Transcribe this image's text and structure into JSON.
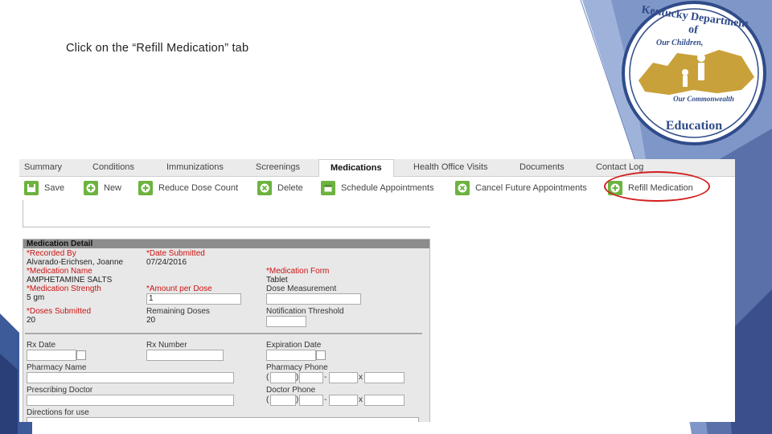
{
  "instruction": "Click on the “Refill Medication” tab",
  "logo": {
    "top_text": "Kentucky Department of",
    "middle_text_1": "Our Children,",
    "middle_text_2": "Our Commonwealth",
    "bottom_text": "Education"
  },
  "tabs": [
    "Summary",
    "Conditions",
    "Immunizations",
    "Screenings",
    "Medications",
    "Health Office Visits",
    "Documents",
    "Contact Log"
  ],
  "toolbar": {
    "save": "Save",
    "new": "New",
    "reduce": "Reduce Dose Count",
    "delete": "Delete",
    "schedule": "Schedule Appointments",
    "cancel": "Cancel Future Appointments",
    "refill": "Refill Medication"
  },
  "detail": {
    "title": "Medication Detail",
    "recorded_by_label": "*Recorded By",
    "recorded_by": "Alvarado-Erichsen, Joanne",
    "date_submitted_label": "*Date Submitted",
    "date_submitted": "07/24/2016",
    "med_name_label": "*Medication Name",
    "med_name": "AMPHETAMINE SALTS",
    "med_form_label": "*Medication Form",
    "med_form": "Tablet",
    "strength_label": "*Medication Strength",
    "strength": "5 gm",
    "amount_label": "*Amount per Dose",
    "amount": "1",
    "dose_measure_label": "Dose Measurement",
    "doses_submitted_label": "*Doses Submitted",
    "doses_submitted": "20",
    "remaining_label": "Remaining Doses",
    "remaining": "20",
    "threshold_label": "Notification Threshold",
    "rx_date_label": "Rx Date",
    "rx_number_label": "Rx Number",
    "expiration_label": "Expiration Date",
    "pharmacy_name_label": "Pharmacy Name",
    "pharmacy_phone_label": "Pharmacy Phone",
    "doctor_label": "Prescribing Doctor",
    "doctor_phone_label": "Doctor Phone",
    "directions_label": "Directions for use"
  },
  "colors": {
    "accent_blue": "#2f4b8a",
    "light_blue": "#8ea5d1",
    "icon_green": "#6db33f",
    "highlight_red": "#d21f1f",
    "logo_gold": "#c9a13a"
  }
}
